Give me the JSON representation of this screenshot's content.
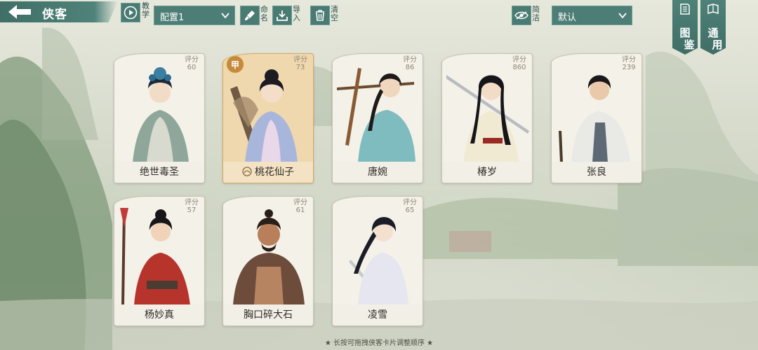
{
  "header": {
    "title": "侠客",
    "tutorial_label": "教学",
    "config_select": "配置1",
    "rename_label": "命名",
    "import_label": "导入",
    "clear_label": "清空",
    "simple_label": "简洁",
    "sort_select": "默认",
    "atlas_label_1": "图",
    "atlas_label_2": "鉴",
    "general_label_1": "通",
    "general_label_2": "用"
  },
  "cards": [
    {
      "name": "绝世毒圣",
      "score_label": "评分",
      "score": "60",
      "selected": false
    },
    {
      "name": "桃花仙子",
      "score_label": "评分",
      "score": "73",
      "selected": true,
      "badge": "甲"
    },
    {
      "name": "唐婉",
      "score_label": "评分",
      "score": "86",
      "selected": false
    },
    {
      "name": "椿岁",
      "score_label": "评分",
      "score": "860",
      "selected": false
    },
    {
      "name": "张良",
      "score_label": "评分",
      "score": "239",
      "selected": false
    },
    {
      "name": "杨妙真",
      "score_label": "评分",
      "score": "57",
      "selected": false
    },
    {
      "name": "胸口碎大石",
      "score_label": "评分",
      "score": "61",
      "selected": false
    },
    {
      "name": "凌雪",
      "score_label": "评分",
      "score": "65",
      "selected": false
    }
  ],
  "footer": {
    "hint": "★ 长按可拖拽侠客卡片调整顺序 ★"
  },
  "colors": {
    "accent": "#4d7e76",
    "selected_card": "#f0d8ae",
    "badge": "#c58b3c"
  }
}
